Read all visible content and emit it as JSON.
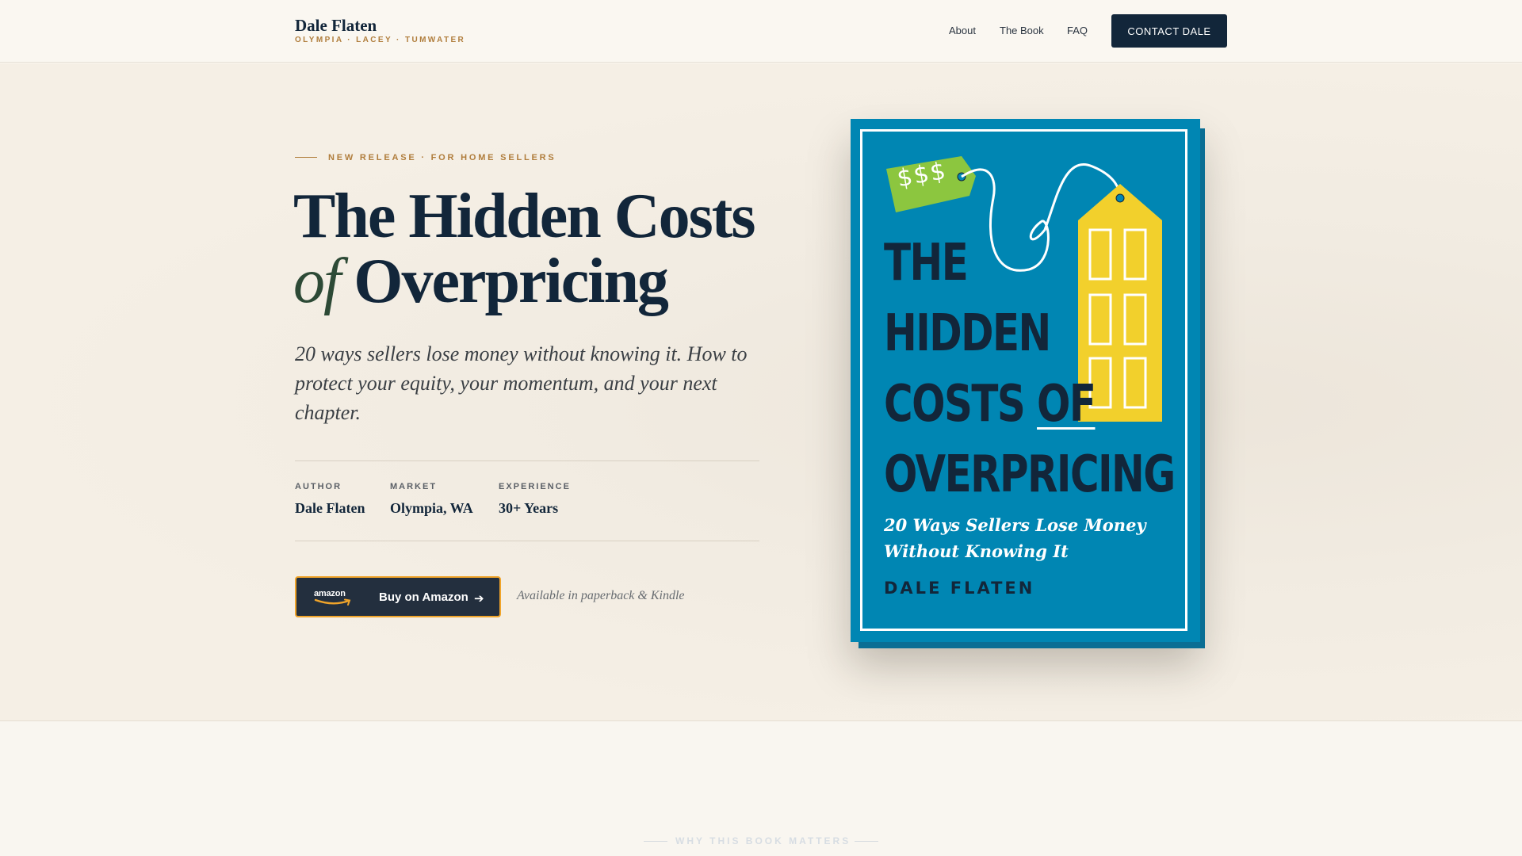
{
  "header": {
    "brand_name": "Dale Flaten",
    "brand_sub": "OLYMPIA · LACEY · TUMWATER",
    "nav": [
      "About",
      "The Book",
      "FAQ"
    ],
    "cta": "CONTACT DALE"
  },
  "hero": {
    "eyebrow": "NEW RELEASE · FOR HOME SELLERS",
    "title_line1": "The Hidden Costs",
    "title_of": "of",
    "title_line2": "Overpricing",
    "subtitle": "20 ways sellers lose money without knowing it. How to protect your equity, your momentum, and your next chapter.",
    "stats": [
      {
        "label": "AUTHOR",
        "value": "Dale Flaten"
      },
      {
        "label": "MARKET",
        "value": "Olympia, WA"
      },
      {
        "label": "EXPERIENCE",
        "value": "30+ Years"
      }
    ],
    "amazon_logo": "amazon",
    "buy_label": "Buy on Amazon",
    "availability": "Available in paperback & Kindle"
  },
  "book_cover": {
    "tag_text": "$$$",
    "title_lines": [
      "THE",
      "HIDDEN",
      "COSTS",
      "OF",
      "OVERPRICING"
    ],
    "subtitle_line1": "20 Ways Sellers Lose Money",
    "subtitle_line2": "Without Knowing It",
    "author": "DALE FLATEN",
    "colors": {
      "background": "#0086b3",
      "title": "#12263a",
      "house": "#f2d02c",
      "tag": "#8cc63f"
    }
  },
  "next_section": {
    "eyebrow": "WHY THIS BOOK MATTERS"
  },
  "colors": {
    "navy": "#12263a",
    "gold": "#b07d3c",
    "amazon_orange": "#f0a42a"
  }
}
